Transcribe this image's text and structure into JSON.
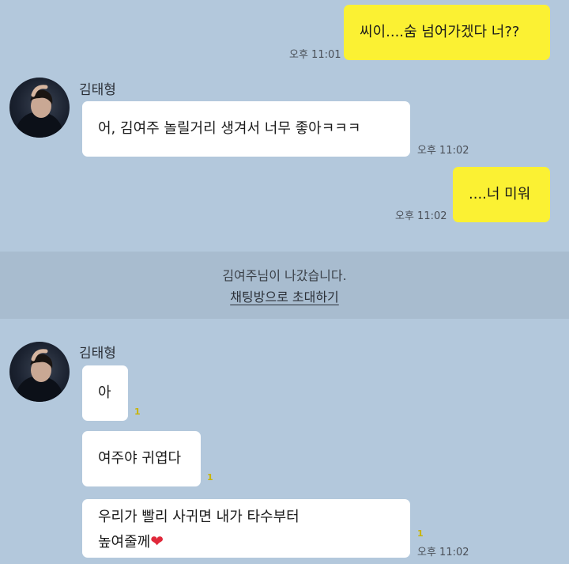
{
  "contact": {
    "name": "김태형"
  },
  "messages": [
    {
      "text": "씨이....숨 넘어가겠다 너??",
      "time": "오후 11:01"
    },
    {
      "text": "어, 김여주 놀릴거리 생겨서 너무 좋아ㅋㅋㅋ",
      "time": "오후 11:02"
    },
    {
      "text": "....너 미워",
      "time": "오후 11:02"
    },
    {
      "text": "아",
      "unread": "1"
    },
    {
      "text": "여주야 귀엽다",
      "unread": "1"
    },
    {
      "line1": "우리가 빨리 사귀면 내가 타수부터",
      "line2": "높여줄께",
      "emoji": "❤",
      "unread": "1",
      "time": "오후 11:02"
    }
  ],
  "notice": {
    "left_text": "김여주님이 나갔습니다.",
    "invite_link": "채팅방으로 초대하기"
  },
  "colors": {
    "background": "#b3c8dc",
    "my_bubble": "#fbf133",
    "their_bubble": "#ffffff",
    "notice_band": "#a8bccf"
  },
  "icons": {
    "avatar": "profile-photo",
    "heart": "red-heart-emoji"
  }
}
